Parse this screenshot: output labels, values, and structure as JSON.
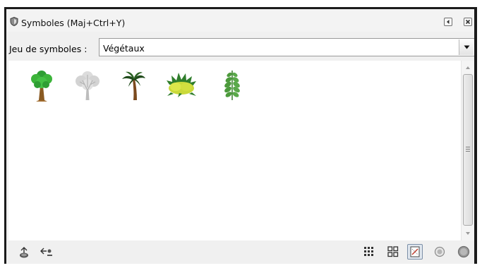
{
  "dialog": {
    "title": "Symboles (Maj+Ctrl+Y)",
    "title_icon": "shield-icon",
    "title_buttons": [
      {
        "name": "collapse-button",
        "icon": "triangle-left-icon"
      },
      {
        "name": "close-button",
        "icon": "close-x-icon"
      }
    ]
  },
  "symbol_set": {
    "label": "Jeu de symboles :",
    "selected": "Végétaux",
    "arrow_icon": "chevron-down-icon"
  },
  "symbols": [
    {
      "name": "tree-green",
      "icon": "green-tree-icon"
    },
    {
      "name": "tree-bare-gray",
      "icon": "gray-tree-icon"
    },
    {
      "name": "palm-tree",
      "icon": "palm-tree-icon"
    },
    {
      "name": "bush",
      "icon": "bush-icon"
    },
    {
      "name": "leaf-branch",
      "icon": "leaf-branch-icon"
    }
  ],
  "toolbar": {
    "left": [
      {
        "name": "add-symbol",
        "icon": "add-symbol-icon"
      },
      {
        "name": "remove-symbol",
        "icon": "remove-symbol-icon"
      }
    ],
    "right": [
      {
        "name": "small-grid",
        "icon": "small-grid-icon"
      },
      {
        "name": "large-grid",
        "icon": "large-grid-icon"
      },
      {
        "name": "fit-symbol",
        "icon": "fit-symbol-icon",
        "pressed": true
      },
      {
        "name": "zoom-out",
        "icon": "zoom-out-circle-icon"
      },
      {
        "name": "zoom-in",
        "icon": "zoom-in-circle-icon"
      }
    ]
  },
  "colors": {
    "frame": "#1b1b1b",
    "panel": "#f0f0f0",
    "tree_green": "#3cb43a",
    "trunk_brown": "#8a5a22",
    "palm_dark": "#1f4a1a",
    "bush_yellow": "#c9d93a",
    "leaf_green": "#4c9a3c"
  }
}
